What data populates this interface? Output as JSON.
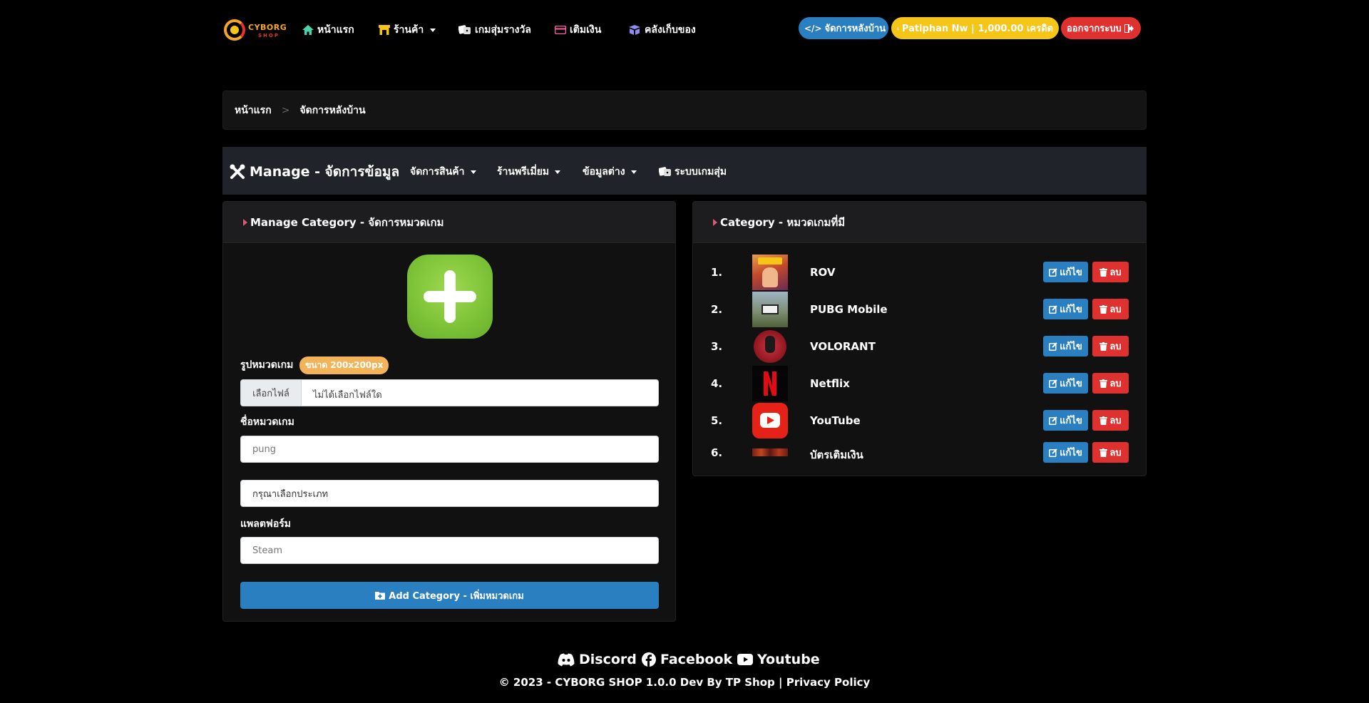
{
  "brand": {
    "name": "CYBORG",
    "sub": "SHOP"
  },
  "nav": {
    "items": [
      {
        "label": "หน้าแรก",
        "icon": "house-icon"
      },
      {
        "label": "ร้านค้า",
        "icon": "shop-icon"
      },
      {
        "label": "เกมสุ่มรางวัล",
        "icon": "dice-icon"
      },
      {
        "label": "เติมเงิน",
        "icon": "credit-card-icon"
      },
      {
        "label": "คลังเก็บของ",
        "icon": "box-icon"
      }
    ],
    "admin_label": "จัดการหลังบ้าน",
    "user_label": "Patiphan Nw | 1,000.00 เครดิต",
    "logout_label": "ออกจากระบบ"
  },
  "breadcrumb": {
    "home": "หน้าแรก",
    "separator": ">",
    "current": "จัดการหลังบ้าน"
  },
  "manage": {
    "title": "Manage - จัดการข้อมูล",
    "menus": [
      "จัดการสินค้า",
      "ร้านพรีเมี่ยม",
      "ข้อมูลต่าง",
      "ระบบเกมสุ่ม"
    ]
  },
  "form": {
    "header": "Manage Category - จัดการหมวดเกม",
    "image_label": "รูปหมวดเกม",
    "image_badge": "ขนาด 200x200px",
    "file_button": "เลือกไฟล์",
    "file_status": "ไม่ได้เลือกไฟล์ใด",
    "name_label": "ชื่อหมวดเกม",
    "name_placeholder": "pung",
    "type_select": "กรุณาเลือกประเภท",
    "platform_label": "แพลตฟอร์ม",
    "platform_placeholder": "Steam",
    "submit_label": "Add Category - เพิ่มหมวดเกม"
  },
  "categories": {
    "header": "Category - หมวดเกมที่มี",
    "edit_label": "แก้ไข",
    "delete_label": "ลบ",
    "items": [
      {
        "num": "1.",
        "name": "ROV"
      },
      {
        "num": "2.",
        "name": "PUBG Mobile"
      },
      {
        "num": "3.",
        "name": "VOLORANT"
      },
      {
        "num": "4.",
        "name": "Netflix"
      },
      {
        "num": "5.",
        "name": "YouTube"
      },
      {
        "num": "6.",
        "name": "บัตรเติมเงิน"
      }
    ]
  },
  "footer": {
    "discord": "Discord",
    "facebook": "Facebook",
    "youtube": "Youtube",
    "copyright": "© 2023 - CYBORG SHOP 1.0.0 Dev By TP Shop |",
    "privacy": "Privacy Policy"
  },
  "colors": {
    "primary": "#2a7fc1",
    "danger": "#e03131",
    "warning": "#f5c518",
    "badge": "#f2b359",
    "background": "#000000"
  }
}
